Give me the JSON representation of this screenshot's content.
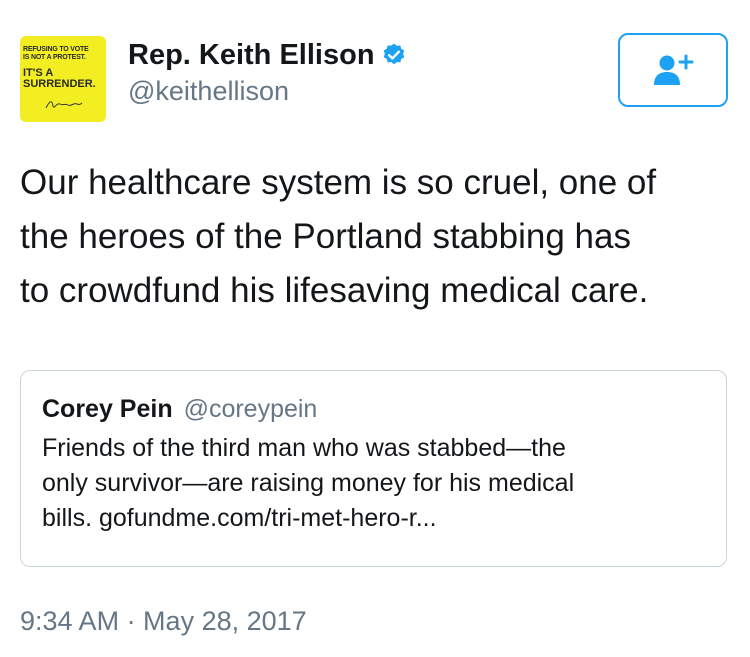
{
  "author": {
    "display_name": "Rep. Keith Ellison",
    "handle": "@keithellison",
    "verified": true,
    "avatar": {
      "background": "#f3ee22",
      "line1": "REFUSING TO VOTE",
      "line2": "IS NOT A PROTEST.",
      "line3": "IT'S A",
      "line4": "SURRENDER."
    }
  },
  "follow_button": {
    "icon": "add-user-icon",
    "color": "#1da1f2"
  },
  "tweet": {
    "text": "Our healthcare system is so cruel, one of\nthe heroes of the Portland stabbing has\nto crowdfund his lifesaving medical care."
  },
  "quoted_tweet": {
    "display_name": "Corey Pein",
    "handle": "@coreypein",
    "text": "Friends of the third man who was stabbed—the\nonly survivor—are raising money for his medical\nbills. gofundme.com/tri-met-hero-r..."
  },
  "timestamp": "9:34 AM · May 28, 2017",
  "colors": {
    "accent": "#1da1f2",
    "secondary_text": "#657786",
    "border": "#ccd6dd"
  }
}
